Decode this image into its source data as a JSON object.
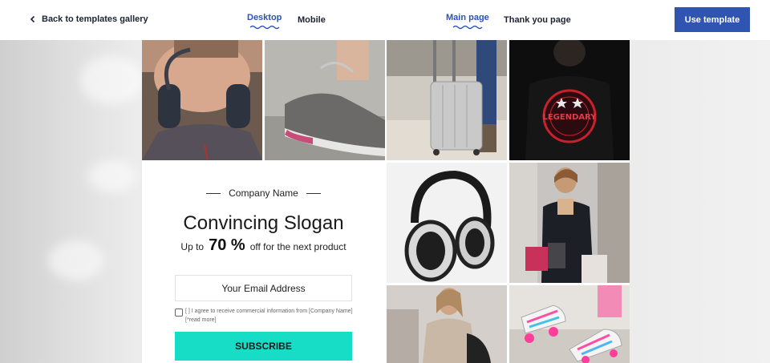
{
  "topbar": {
    "back_label": "Back to templates gallery",
    "device_tabs": [
      {
        "label": "Desktop",
        "active": true
      },
      {
        "label": "Mobile",
        "active": false
      }
    ],
    "page_tabs": [
      {
        "label": "Main page",
        "active": true
      },
      {
        "label": "Thank you page",
        "active": false
      }
    ],
    "use_template_label": "Use template"
  },
  "template": {
    "company_name": "Company Name",
    "slogan": "Convincing Slogan",
    "discount_prefix": "Up to",
    "discount_value": "70 %",
    "discount_suffix": "off for the next product",
    "email_placeholder": "Your Email Address",
    "consent_text": "[ ] I agree to receive commercial information from [Company Name] [*read more]",
    "subscribe_label": "SUBSCRIBE",
    "photos": [
      {
        "name": "woman-headphones-photo"
      },
      {
        "name": "sneaker-photo"
      },
      {
        "name": "suitcase-photo"
      },
      {
        "name": "legendary-tshirt-photo",
        "text": "LEGENDARY"
      },
      {
        "name": "white-headphones-photo"
      },
      {
        "name": "shopping-woman-photo"
      },
      {
        "name": "woman-coat-photo"
      },
      {
        "name": "roller-skates-photo"
      }
    ]
  },
  "colors": {
    "accent_blue": "#2f55b1",
    "subscribe_teal": "#17dcc6"
  }
}
